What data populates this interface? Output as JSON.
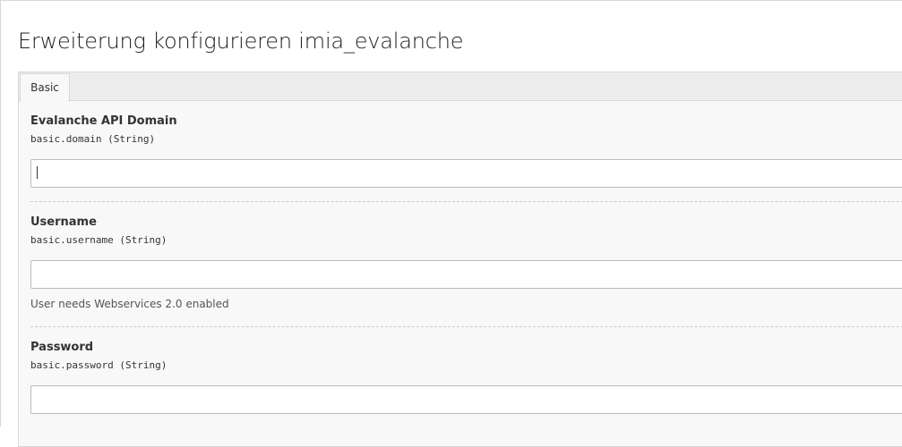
{
  "page": {
    "title": "Erweiterung konfigurieren imia_evalanche"
  },
  "tabs": [
    {
      "label": "Basic",
      "active": true
    }
  ],
  "fields": [
    {
      "label": "Evalanche API Domain",
      "key": "basic.domain (String)",
      "value": "",
      "focused": true,
      "help": ""
    },
    {
      "label": "Username",
      "key": "basic.username (String)",
      "value": "",
      "focused": false,
      "help": "User needs Webservices 2.0 enabled"
    },
    {
      "label": "Password",
      "key": "basic.password (String)",
      "value": "",
      "focused": false,
      "help": ""
    }
  ]
}
